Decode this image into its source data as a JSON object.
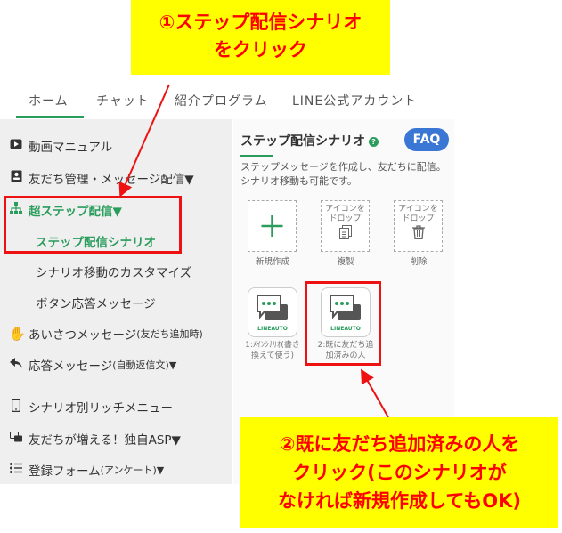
{
  "callout1": {
    "line1": "①ステップ配信シナリオ",
    "line2": "をクリック"
  },
  "callout2": {
    "line1": "②既に友だち追加済みの人を",
    "line2": "クリック(このシナリオが",
    "line3": "なければ新規作成してもOK)"
  },
  "tabs": [
    "ホーム",
    "チャット",
    "紹介プログラム",
    "LINE公式アカウント"
  ],
  "sidebar": {
    "video_manual": "動画マニュアル",
    "friend_mgmt": "友だち管理・メッセージ配信▼",
    "super_step": "超ステップ配信▼",
    "step_scenario": "ステップ配信シナリオ",
    "scenario_move": "シナリオ移動のカスタマイズ",
    "button_reply": "ボタン応答メッセージ",
    "greeting": "あいさつメッセージ",
    "greeting_sub": "(友だち追加時)",
    "auto_reply": "応答メッセージ",
    "auto_reply_sub": "(自動返信文)▼",
    "rich_menu": "シナリオ別リッチメニュー",
    "asp": "友だちが増える！独自ASP▼",
    "form": "登録フォーム",
    "form_sub": "(アンケート)▼"
  },
  "main": {
    "title": "ステップ配信シナリオ",
    "help": "?",
    "faq": "FAQ",
    "description": "ステップメッセージを作成し、友だちに配信。シナリオ移動も可能です。",
    "tiles": {
      "new_label": "新規作成",
      "copy_drop1": "アイコンを",
      "copy_drop2": "ドロップ",
      "copy_label": "複製",
      "delete_drop1": "アイコンを",
      "delete_drop2": "ドロップ",
      "delete_label": "削除"
    },
    "scenarios": [
      {
        "brand": "LINEAUTO",
        "label1": "1:ﾒｲﾝｼﾅﾘｵ(書き",
        "label2": "換えて使う)"
      },
      {
        "brand": "LINEAUTO",
        "label1": "2:既に友だち追",
        "label2": "加済みの人"
      }
    ]
  },
  "colors": {
    "accent_green": "#2a9d5c",
    "faq_blue": "#3a76d4",
    "highlight_red": "#ee1111",
    "callout_yellow": "#ffff00"
  }
}
